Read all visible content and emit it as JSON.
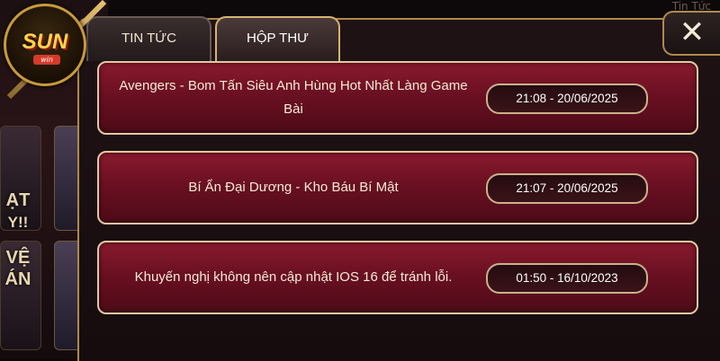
{
  "logo": {
    "brand": "SUN",
    "sub": "win"
  },
  "background": {
    "corner_text": "Tin Tức",
    "card_texts": [
      "ẠT",
      "Y!!",
      "VỆ",
      "ÁN"
    ]
  },
  "tabs": [
    {
      "label": "TIN TỨC",
      "active": false
    },
    {
      "label": "HỘP THƯ",
      "active": true
    }
  ],
  "close_label": "✕",
  "messages": [
    {
      "title": "Avengers - Bom Tấn Siêu Anh Hùng Hot Nhất Làng Game Bài",
      "time": "21:08 - 20/06/2025"
    },
    {
      "title": "Bí Ẩn Đại Dương - Kho Báu Bí Mật",
      "time": "21:07 - 20/06/2025"
    },
    {
      "title": "Khuyến nghị không nên cập nhật IOS 16 để tránh lỗi.",
      "time": "01:50 - 16/10/2023"
    }
  ],
  "colors": {
    "item_bg": "#7a1426",
    "item_border": "#e0c9a0",
    "panel_border": "#b08a4a",
    "logo_gold": "#ffd54a"
  }
}
